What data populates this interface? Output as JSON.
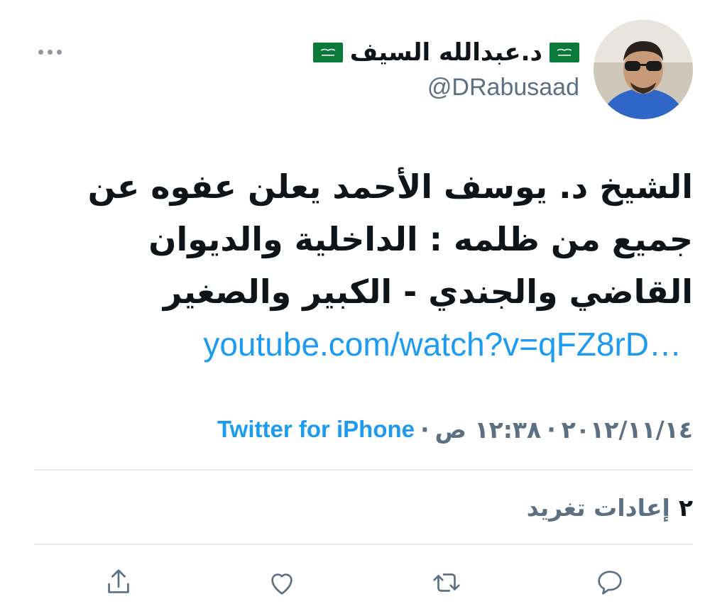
{
  "header": {
    "display_name": "د.عبدالله السيف",
    "handle": "@DRabusaad",
    "more_icon": "more-horizontal-icon",
    "avatar_icon": "avatar"
  },
  "tweet": {
    "lines": [
      "الشيخ د. يوسف الأحمد يعلن عفوه عن",
      "جميع من ظلمه : الداخلية والديوان",
      "القاضي والجندي - الكبير والصغير"
    ],
    "link": "youtube.com/watch?v=qFZ8rD…"
  },
  "meta": {
    "date": "٢٠١٢/١١/١٤",
    "separator": "·",
    "time": "١٢:٣٨ ص",
    "source": "Twitter for iPhone"
  },
  "stats": {
    "retweets_count": "٢",
    "retweets_label": "إعادات تغريد"
  },
  "actions": {
    "reply_icon": "reply-icon",
    "retweet_icon": "retweet-icon",
    "like_icon": "heart-icon",
    "share_icon": "share-icon"
  },
  "colors": {
    "link": "#1d9bf0",
    "secondary": "#5b7083",
    "divider": "#e6ecf0",
    "flag_green": "#0a7a3a"
  }
}
